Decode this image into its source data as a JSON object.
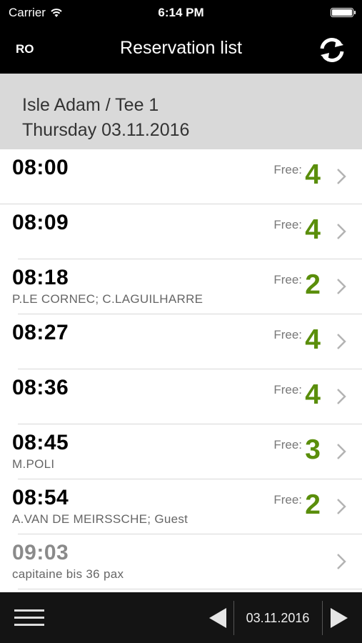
{
  "status_bar": {
    "carrier": "Carrier",
    "time": "6:14 PM"
  },
  "nav": {
    "left_label": "RO",
    "title": "Reservation list",
    "refresh_icon": "refresh-icon"
  },
  "section": {
    "line1": "Isle Adam / Tee 1",
    "line2": "Thursday 03.11.2016"
  },
  "rows": [
    {
      "time": "08:00",
      "names": "",
      "free_label": "Free:",
      "free": "4"
    },
    {
      "time": "08:09",
      "names": "",
      "free_label": "Free:",
      "free": "4"
    },
    {
      "time": "08:18",
      "names": "P.LE CORNEC; C.LAGUILHARRE",
      "free_label": "Free:",
      "free": "2"
    },
    {
      "time": "08:27",
      "names": "",
      "free_label": "Free:",
      "free": "4"
    },
    {
      "time": "08:36",
      "names": "",
      "free_label": "Free:",
      "free": "4"
    },
    {
      "time": "08:45",
      "names": "M.POLI",
      "free_label": "Free:",
      "free": "3"
    },
    {
      "time": "08:54",
      "names": "A.VAN DE MEIRSSCHE; Guest",
      "free_label": "Free:",
      "free": "2"
    },
    {
      "time": "09:03",
      "names": "capitaine bis 36 pax",
      "free_label": "",
      "free": ""
    }
  ],
  "toolbar": {
    "date": "03.11.2016"
  },
  "colors": {
    "accent_green": "#5a8e0b",
    "header_gray": "#d9d9d9",
    "bar_black": "#000000"
  }
}
